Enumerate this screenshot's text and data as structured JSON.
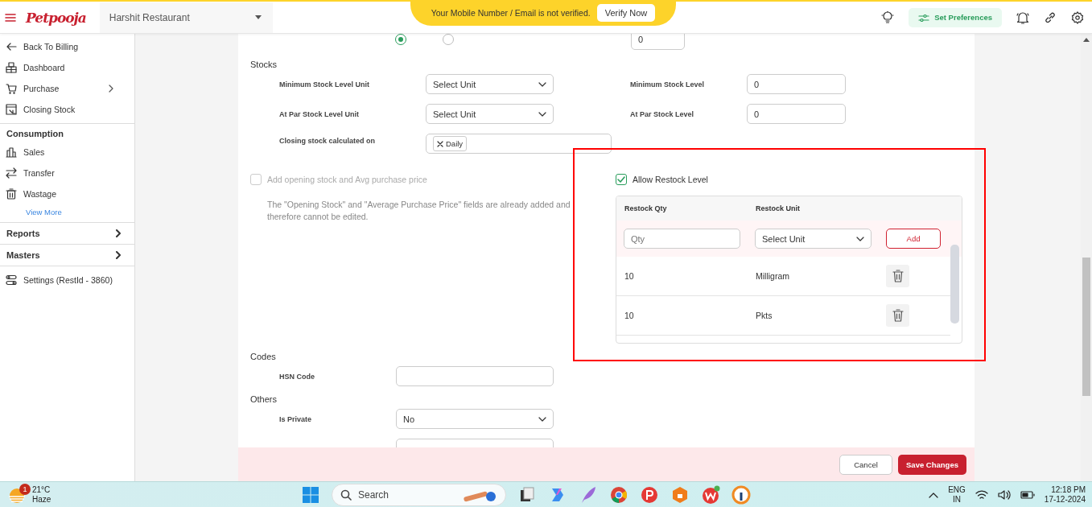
{
  "header": {
    "logo": "Petpooja",
    "restaurant": "Harshit Restaurant",
    "banner": {
      "message": "Your Mobile Number / Email is not verified.",
      "action": "Verify Now"
    },
    "preferences": "Set Preferences"
  },
  "sidebar": [
    {
      "kind": "item",
      "label": "Back To Billing"
    },
    {
      "kind": "item",
      "label": "Dashboard"
    },
    {
      "kind": "submenu",
      "label": "Purchase"
    },
    {
      "kind": "item",
      "label": "Closing Stock"
    },
    {
      "kind": "heading",
      "label": "Consumption"
    },
    {
      "kind": "item",
      "label": "Sales"
    },
    {
      "kind": "item",
      "label": "Transfer"
    },
    {
      "kind": "item",
      "label": "Wastage"
    },
    {
      "kind": "link",
      "label": "View More"
    },
    {
      "kind": "group",
      "label": "Reports"
    },
    {
      "kind": "group",
      "label": "Masters"
    },
    {
      "kind": "item",
      "label": "Settings (RestId - 3860)"
    }
  ],
  "form": {
    "top_row": {
      "radios": [
        {
          "selected": true
        },
        {
          "selected": false
        }
      ],
      "value": "0"
    },
    "stocks": {
      "title": "Stocks",
      "rows": [
        {
          "label": "Minimum Stock Level Unit",
          "kind": "select",
          "value": "Select Unit",
          "side_label": "Minimum Stock Level",
          "side_value": "0"
        },
        {
          "label": "At Par Stock Level Unit",
          "kind": "select",
          "value": "Select Unit",
          "side_label": "At Par Stock Level",
          "side_value": "0"
        },
        {
          "label": "Closing stock calculated on",
          "kind": "tags",
          "tags": [
            "Daily"
          ]
        }
      ]
    },
    "opening_stock": {
      "label": "Add opening stock and Avg purchase price",
      "checked": false,
      "disabled": true,
      "note": "The \"Opening Stock\" and \"Average Purchase Price\" fields are already added and therefore cannot be edited."
    },
    "restock": {
      "label": "Allow Restock Level",
      "checked": true,
      "columns": [
        "Restock Qty",
        "Restock Unit"
      ],
      "new_row": {
        "qty_placeholder": "Qty",
        "unit": "Select Unit",
        "action": "Add"
      },
      "rows": [
        {
          "qty": "10",
          "unit": "Milligram"
        },
        {
          "qty": "10",
          "unit": "Pkts"
        }
      ]
    },
    "codes": {
      "title": "Codes",
      "rows": [
        {
          "label": "HSN Code",
          "kind": "input"
        }
      ]
    },
    "others": {
      "title": "Others",
      "rows": [
        {
          "label": "Is Private",
          "kind": "select",
          "value": "No"
        },
        {
          "kind": "input"
        }
      ]
    }
  },
  "footer": {
    "cancel": "Cancel",
    "save": "Save Changes"
  },
  "taskbar": {
    "weather": {
      "badge": "1",
      "temp": "21°C",
      "condition": "Haze"
    },
    "search_placeholder": "Search",
    "language": "ENG",
    "region": "IN",
    "time": "12:18 PM",
    "date": "17-12-2024"
  }
}
